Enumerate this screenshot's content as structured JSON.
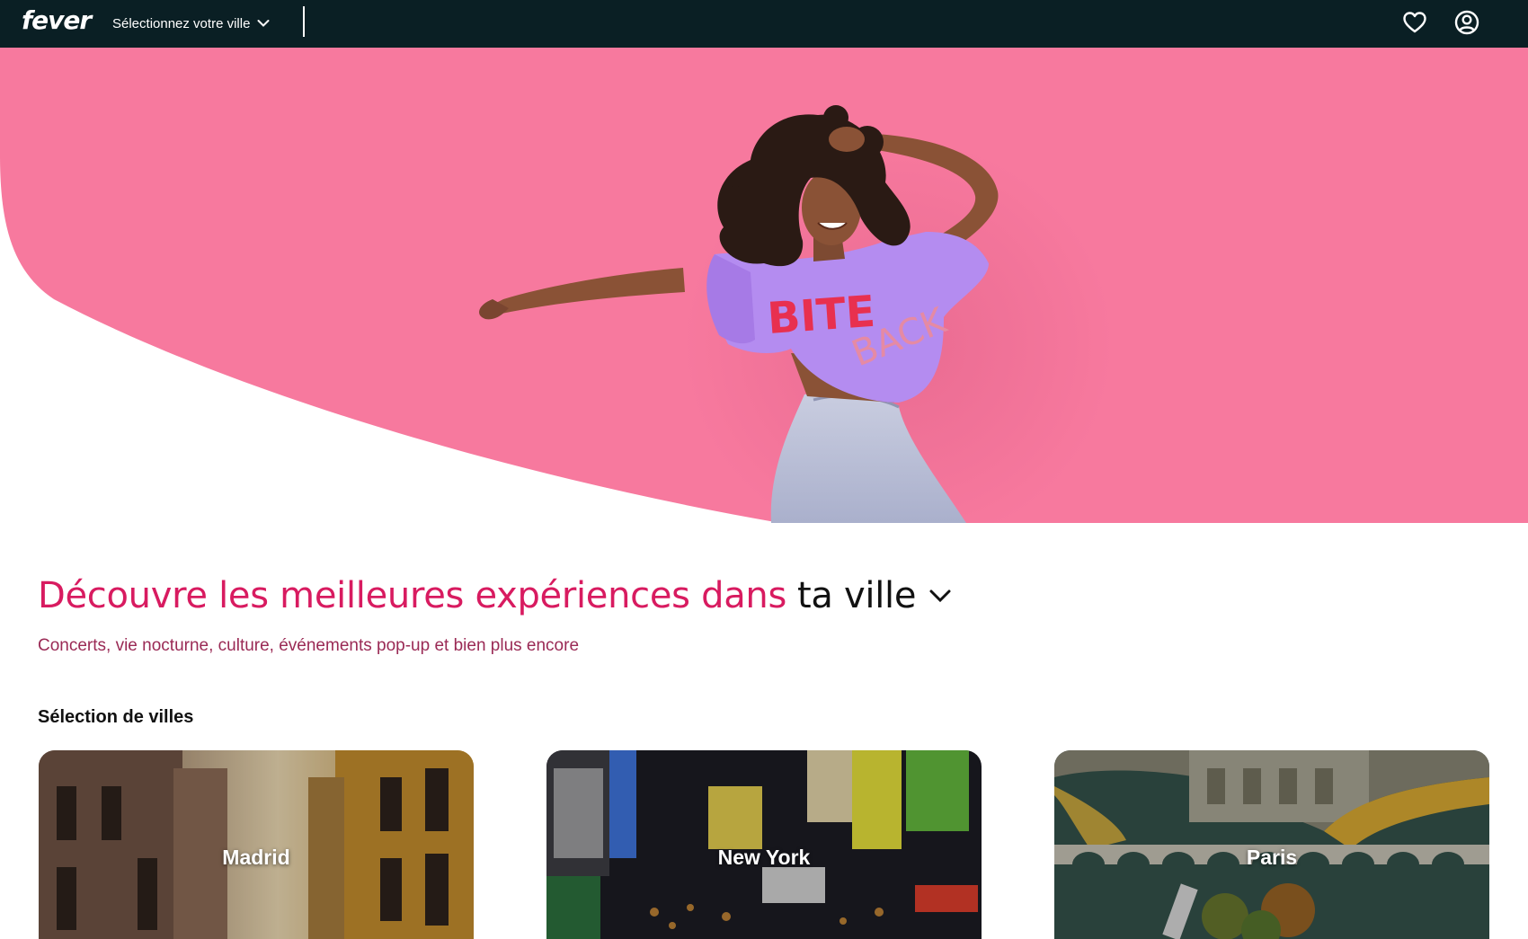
{
  "nav": {
    "logo": "fever",
    "city_select_label": "Sélectionnez votre ville"
  },
  "colors": {
    "nav_bg": "#0a1f24",
    "hero_pink": "#f7799e",
    "accent_pink": "#d81b60",
    "subtitle": "#9a2a55"
  },
  "headline": {
    "pink_text": "Découvre les meilleures expériences dans",
    "dark_text": "ta ville"
  },
  "subtitle": "Concerts, vie nocturne, culture, événements pop-up et bien plus encore",
  "cities_section": {
    "title": "Sélection de villes",
    "cities": [
      {
        "name": "Madrid"
      },
      {
        "name": "New York"
      },
      {
        "name": "Paris"
      }
    ]
  },
  "icons": [
    "chevron-down-icon",
    "heart-icon",
    "user-account-icon"
  ]
}
